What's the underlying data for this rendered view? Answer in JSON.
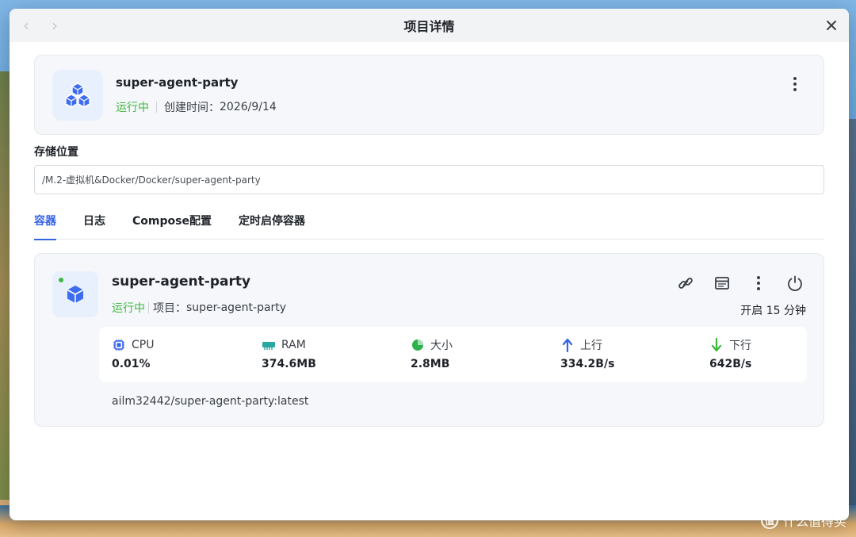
{
  "window": {
    "title": "项目详情"
  },
  "project": {
    "name": "super-agent-party",
    "status": "运行中",
    "created_label": "创建时间：",
    "created_value": "2026/9/14",
    "icon": "cubes-icon"
  },
  "storage": {
    "label": "存储位置",
    "path": "/M.2-虚拟机&Docker/Docker/super-agent-party"
  },
  "tabs": [
    {
      "label": "容器",
      "active": true
    },
    {
      "label": "日志",
      "active": false
    },
    {
      "label": "Compose配置",
      "active": false
    },
    {
      "label": "定时启停容器",
      "active": false
    }
  ],
  "container": {
    "name": "super-agent-party",
    "status": "运行中",
    "project_label": "项目：",
    "project_value": "super-agent-party",
    "uptime": "开启 15 分钟",
    "image": "ailm32442/super-agent-party:latest",
    "stats": [
      {
        "label": "CPU",
        "value": "0.01%",
        "icon": "cpu-icon"
      },
      {
        "label": "RAM",
        "value": "374.6MB",
        "icon": "ram-icon"
      },
      {
        "label": "大小",
        "value": "2.8MB",
        "icon": "pie-chart-icon"
      },
      {
        "label": "上行",
        "value": "334.2B/s",
        "icon": "arrow-up-icon"
      },
      {
        "label": "下行",
        "value": "642B/s",
        "icon": "arrow-down-icon"
      }
    ]
  },
  "watermark": {
    "badge": "值",
    "text": "什么值得买"
  },
  "colors": {
    "accent": "#3563e9",
    "running": "#3fb73f",
    "upload": "#3563e9",
    "download": "#3fb73f"
  }
}
